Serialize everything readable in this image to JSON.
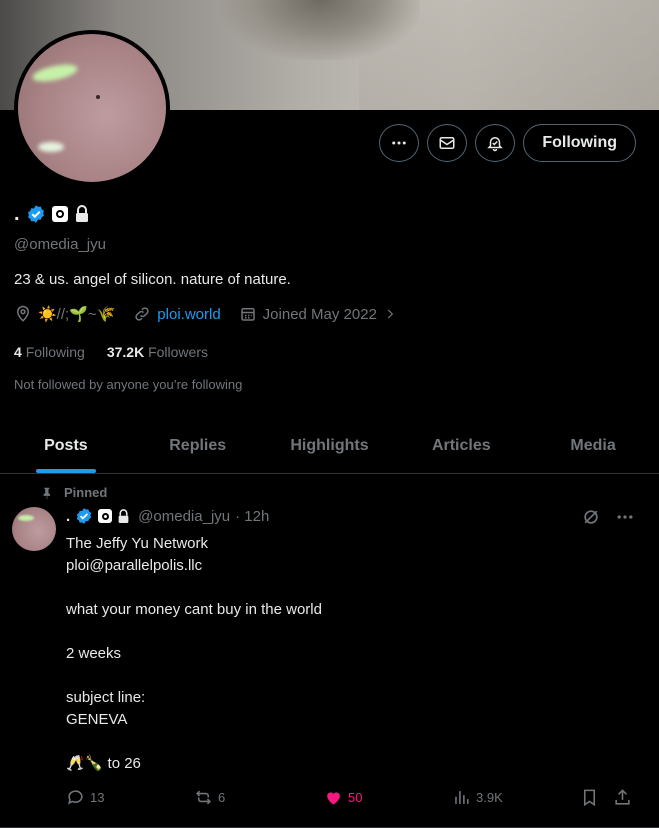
{
  "profile": {
    "name": ".",
    "handle": "@omedia_jyu",
    "bio": "23 & us. angel of silicon. nature of nature.",
    "location": "☀️//;🌱~🌾",
    "website": "ploi.world",
    "joined": "Joined May 2022",
    "following_count": "4",
    "following_label": "Following",
    "followers_count": "37.2K",
    "followers_label": "Followers",
    "not_followed_text": "Not followed by anyone you’re following",
    "follow_button": "Following"
  },
  "icons": {
    "more": "more-icon",
    "message": "mail-icon",
    "notify": "bell-icon",
    "verified": "verified-badge-icon",
    "lock": "lock-icon",
    "location": "location-icon",
    "link": "link-icon",
    "calendar": "calendar-icon"
  },
  "colors": {
    "accent": "#1d9bf0",
    "like": "#f91880",
    "muted": "#71767b",
    "border": "#2f3336"
  },
  "tabs": [
    {
      "label": "Posts",
      "active": true
    },
    {
      "label": "Replies"
    },
    {
      "label": "Highlights"
    },
    {
      "label": "Articles"
    },
    {
      "label": "Media"
    }
  ],
  "post": {
    "pinned_label": "Pinned",
    "name": ".",
    "handle": "@omedia_jyu",
    "time": "· 12h",
    "body": "The Jeffy Yu Network\nploi@parallelpolis.llc\n\nwhat your money cant buy in the world\n\n2 weeks\n\nsubject line:\nGENEVA\n\n🥂🍾 to 26",
    "replies": "13",
    "reposts": "6",
    "likes": "50",
    "views": "3.9K"
  }
}
